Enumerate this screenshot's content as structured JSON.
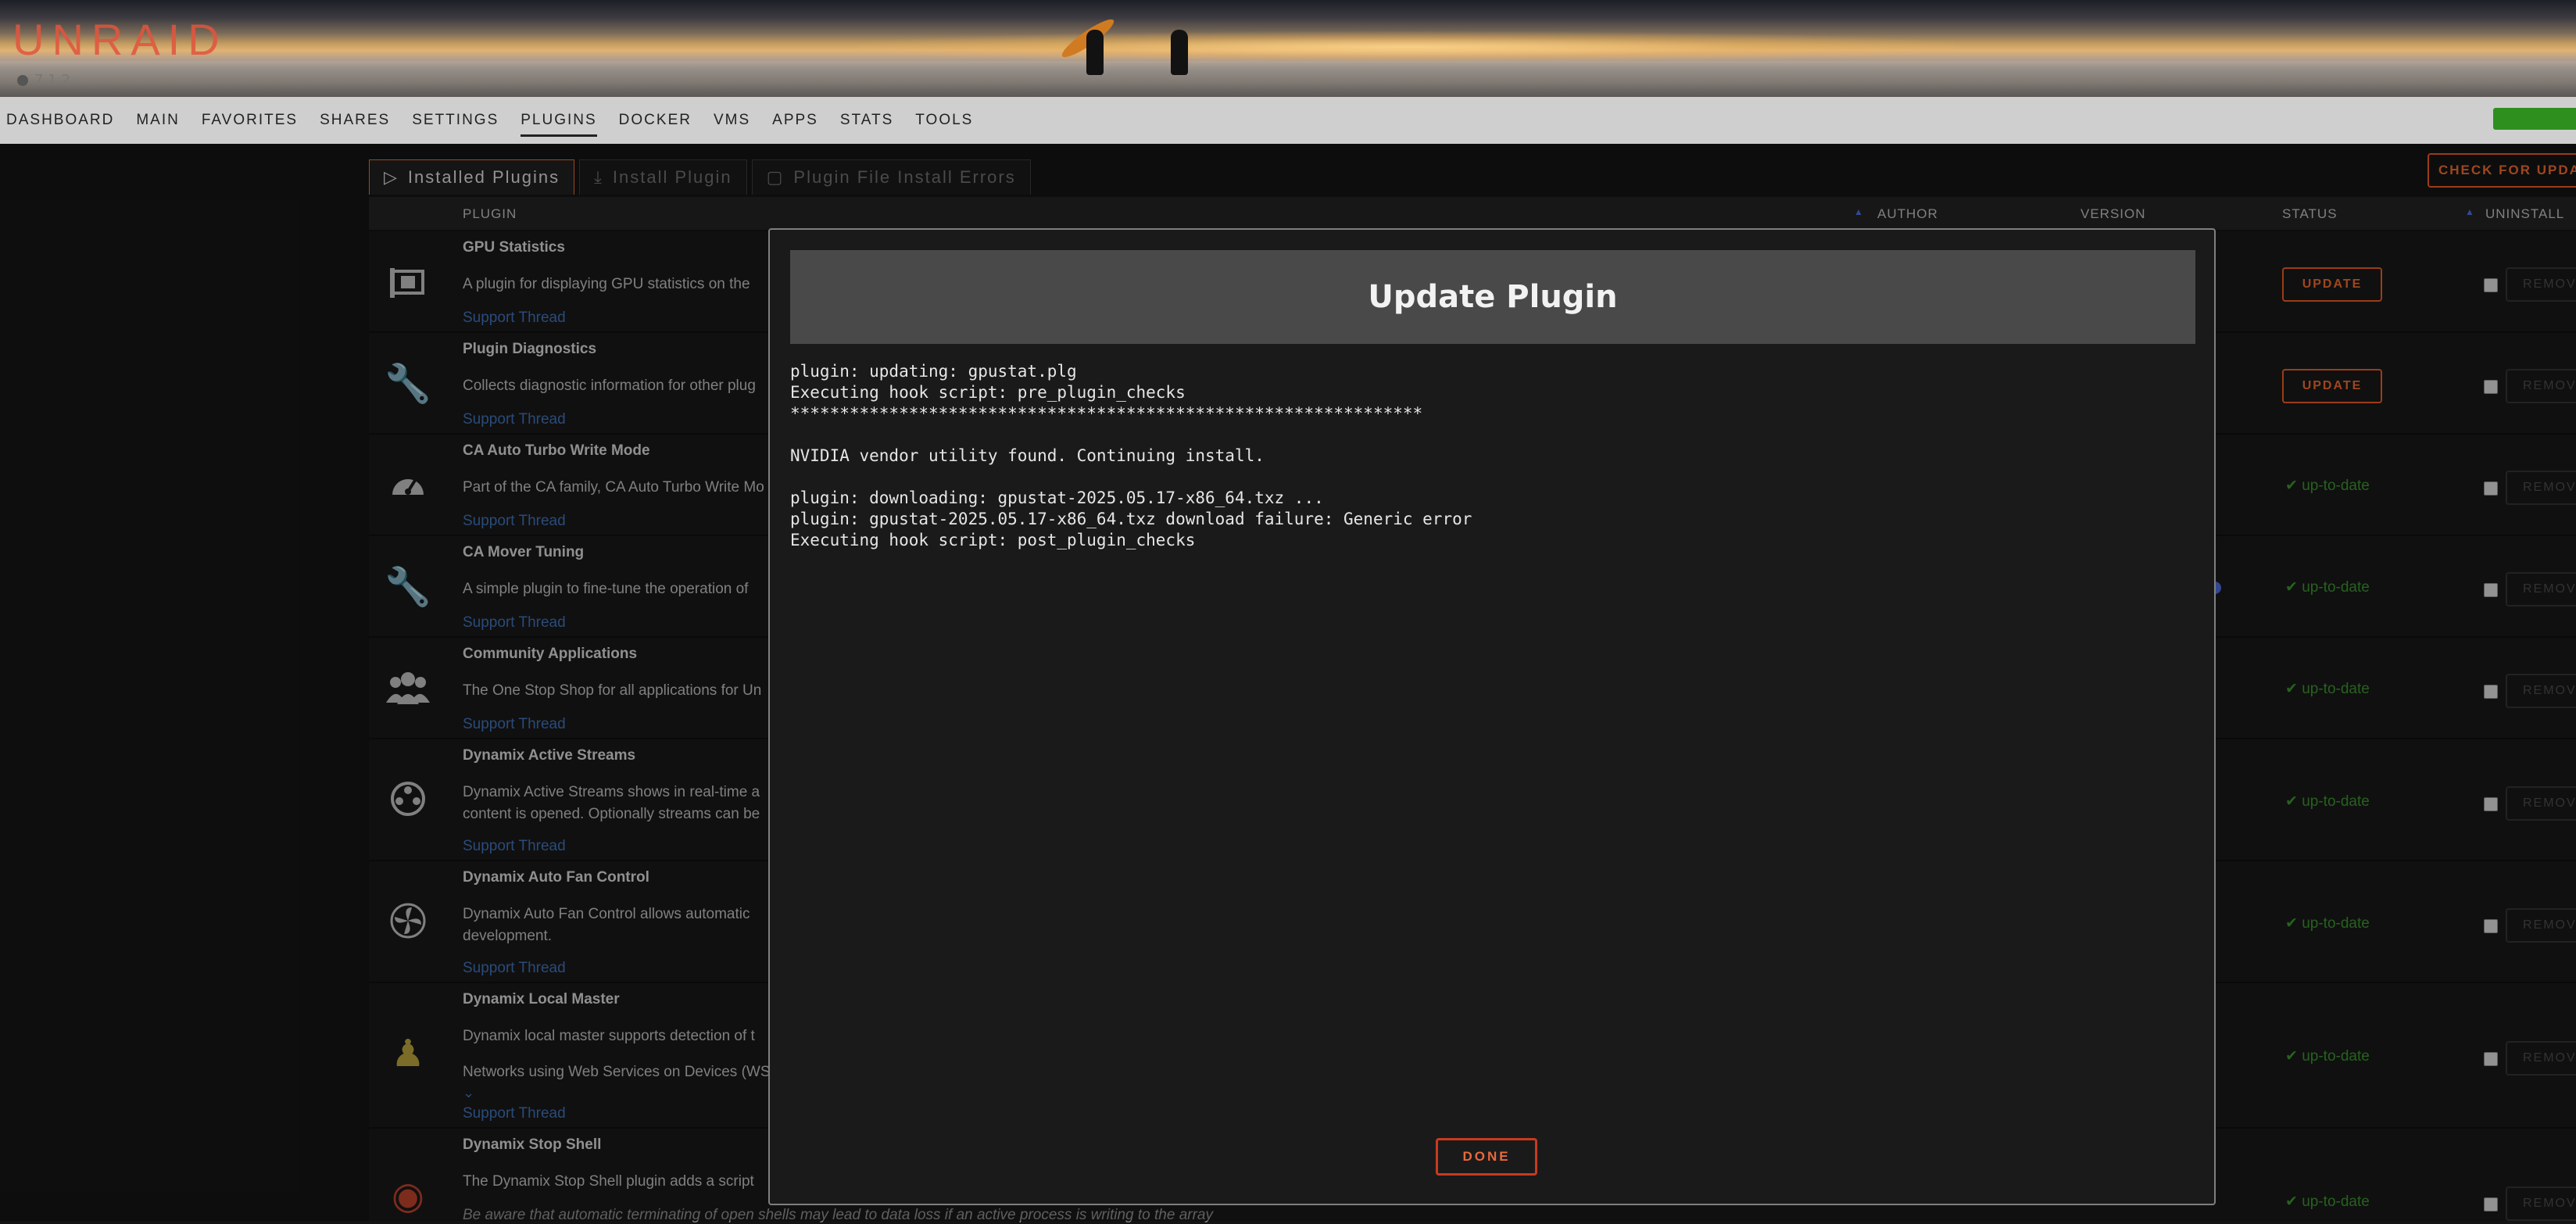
{
  "brand": {
    "logo": "UNRAID",
    "version": "7.1.2"
  },
  "nav": [
    "DASHBOARD",
    "MAIN",
    "FAVORITES",
    "SHARES",
    "SETTINGS",
    "PLUGINS",
    "DOCKER",
    "VMS",
    "APPS",
    "STATS",
    "TOOLS"
  ],
  "nav_active": "PLUGINS",
  "tabs": [
    {
      "label": "Installed Plugins",
      "icon": "plugin-icon"
    },
    {
      "label": "Install Plugin",
      "icon": "download-icon"
    },
    {
      "label": "Plugin File Install Errors",
      "icon": "puzzle-icon"
    }
  ],
  "check_updates_label": "CHECK FOR UPDATES",
  "table": {
    "headers": {
      "plugin": "PLUGIN",
      "author": "AUTHOR",
      "version": "VERSION",
      "status": "STATUS",
      "uninstall": "UNINSTALL"
    },
    "rows": [
      {
        "name": "GPU Statistics",
        "desc": "A plugin for displaying GPU statistics on the",
        "support": "Support Thread",
        "status": "UPDATE",
        "icon": "gpu-card-icon"
      },
      {
        "name": "Plugin Diagnostics",
        "desc": "Collects diagnostic information for other plug",
        "support": "Support Thread",
        "status": "UPDATE",
        "icon": "wrench-icon"
      },
      {
        "name": "CA Auto Turbo Write Mode",
        "desc": "Part of the CA family, CA Auto Turbo Write Mo",
        "support": "Support Thread",
        "status": "up-to-date",
        "icon": "speedometer-icon"
      },
      {
        "name": "CA Mover Tuning",
        "desc": "A simple plugin to fine-tune the operation of",
        "support": "Support Thread",
        "status": "up-to-date",
        "icon": "wrench-icon"
      },
      {
        "name": "Community Applications",
        "desc": "The One Stop Shop for all applications for Un",
        "support": "Support Thread",
        "status": "up-to-date",
        "icon": "users-icon"
      },
      {
        "name": "Dynamix Active Streams",
        "desc": "Dynamix Active Streams shows in real-time a",
        "desc2": "content is opened. Optionally streams can be",
        "support": "Support Thread",
        "status": "up-to-date",
        "icon": "film-reel-icon"
      },
      {
        "name": "Dynamix Auto Fan Control",
        "desc": "Dynamix Auto Fan Control allows automatic",
        "desc2": "development.",
        "support": "Support Thread",
        "status": "up-to-date",
        "icon": "fan-icon"
      },
      {
        "name": "Dynamix Local Master",
        "desc": "Dynamix local master supports detection of t",
        "desc2": "Networks using Web Services on Devices (WS",
        "support": "Support Thread",
        "status": "up-to-date",
        "icon": "local-master-icon"
      },
      {
        "name": "Dynamix Stop Shell",
        "desc": "The Dynamix Stop Shell plugin adds a script",
        "note": "Be aware that automatic terminating of open shells may lead to data loss if an active process is writing to the array",
        "status": "up-to-date",
        "icon": "shell-icon"
      }
    ],
    "remove_label": "REMOVE"
  },
  "modal": {
    "title": "Update Plugin",
    "log": [
      "plugin: updating: gpustat.plg",
      "Executing hook script: pre_plugin_checks",
      "****************************************************************",
      "",
      "NVIDIA vendor utility found. Continuing install.",
      "",
      "plugin: downloading: gpustat-2025.05.17-x86_64.txz ...",
      "plugin: gpustat-2025.05.17-x86_64.txz download failure: Generic error",
      "Executing hook script: post_plugin_checks"
    ],
    "done_label": "DONE"
  },
  "colors": {
    "accent": "#e45a22",
    "ok": "#3a8f2e",
    "link": "#3e6fb3",
    "nav_bg": "#cfcfcf"
  }
}
